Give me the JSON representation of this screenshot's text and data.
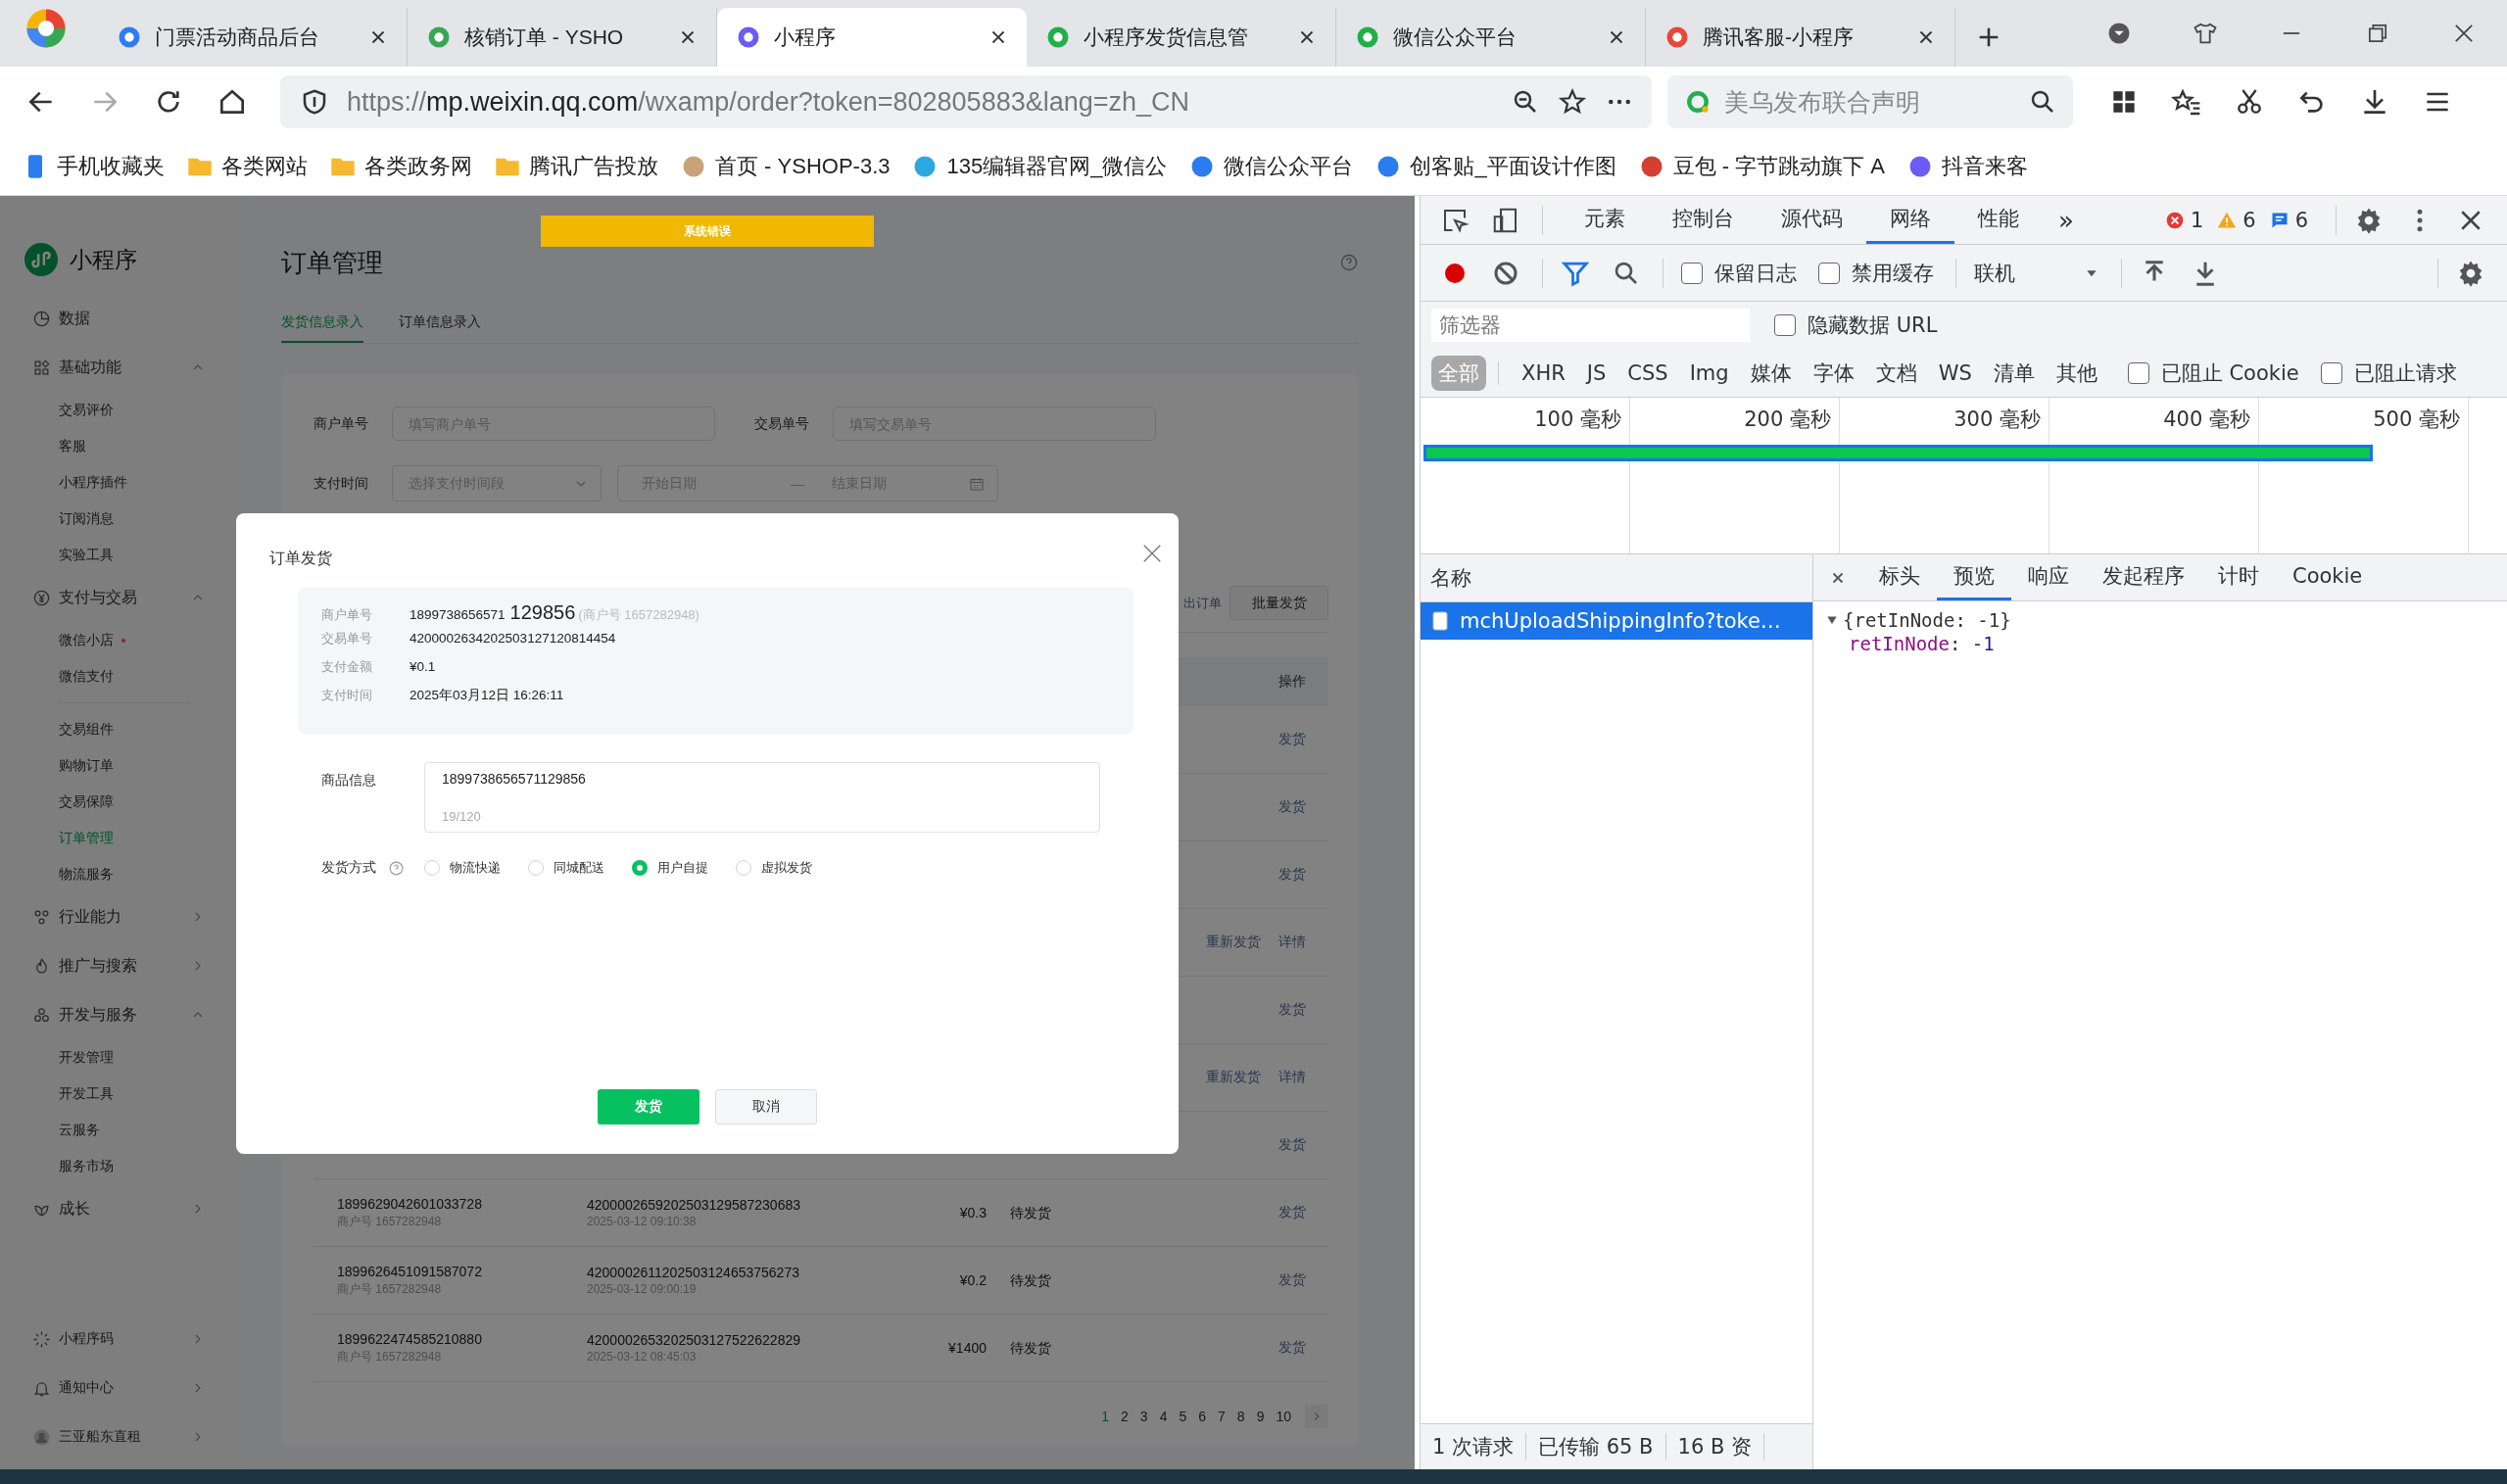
{
  "browser": {
    "tabs": [
      {
        "title": "门票活动商品后台",
        "selected": false
      },
      {
        "title": "核销订单 - YSHO",
        "selected": false
      },
      {
        "title": "小程序",
        "selected": true
      },
      {
        "title": "小程序发货信息管",
        "selected": false
      },
      {
        "title": "微信公众平台",
        "selected": false
      },
      {
        "title": "腾讯客服-小程序",
        "selected": false
      }
    ],
    "url": "https://**mp.weixin.qq.com**/wxamp/order?token=802805883&lang=zh_CN",
    "search": {
      "placeholder": "美乌发布联合声明"
    },
    "bookmarks": [
      {
        "label": "手机收藏夹",
        "kind": "phone"
      },
      {
        "label": "各类网站",
        "kind": "folder"
      },
      {
        "label": "各类政务网",
        "kind": "folder"
      },
      {
        "label": "腾讯广告投放",
        "kind": "folder"
      },
      {
        "label": "首页 - YSHOP-3.3",
        "kind": "site"
      },
      {
        "label": "135编辑器官网_微信公",
        "kind": "site"
      },
      {
        "label": "微信公众平台",
        "kind": "site"
      },
      {
        "label": "创客贴_平面设计作图",
        "kind": "site"
      },
      {
        "label": "豆包 - 字节跳动旗下 A",
        "kind": "site"
      },
      {
        "label": "抖音来客",
        "kind": "site"
      }
    ]
  },
  "page": {
    "error_banner": "系统错误",
    "sidebar": {
      "title": "小程序",
      "groups": [
        {
          "label": "数据"
        },
        {
          "label": "基础功能",
          "expanded": true,
          "children": [
            {
              "label": "交易评价",
              "selected": false
            },
            {
              "label": "客服",
              "selected": false
            },
            {
              "label": "小程序插件",
              "selected": false
            },
            {
              "label": "订阅消息",
              "selected": false
            },
            {
              "label": "实验工具",
              "selected": false
            }
          ]
        },
        {
          "label": "支付与交易",
          "expanded": true,
          "children": [
            {
              "label": "微信小店",
              "selected": false,
              "dot": true
            },
            {
              "label": "微信支付",
              "selected": false
            },
            {
              "label": "交易组件",
              "selected": false,
              "divider_before": true
            },
            {
              "label": "购物订单",
              "selected": false
            },
            {
              "label": "交易保障",
              "selected": false
            },
            {
              "label": "订单管理",
              "selected": true
            },
            {
              "label": "物流服务",
              "selected": false
            }
          ]
        },
        {
          "label": "行业能力",
          "expanded": false
        },
        {
          "label": "推广与搜索",
          "expanded": false
        },
        {
          "label": "开发与服务",
          "expanded": true,
          "children": [
            {
              "label": "开发管理",
              "selected": false
            },
            {
              "label": "开发工具",
              "selected": false
            },
            {
              "label": "云服务",
              "selected": false
            },
            {
              "label": "服务市场",
              "selected": false
            }
          ]
        },
        {
          "label": "成长",
          "expanded": false
        }
      ],
      "footer": [
        {
          "label": "小程序码"
        },
        {
          "label": "通知中心"
        },
        {
          "label": "三亚船东直租"
        }
      ]
    },
    "title": "订单管理",
    "tabs": [
      {
        "label": "发货信息录入",
        "selected": true
      },
      {
        "label": "订单信息录入",
        "selected": false
      }
    ],
    "filters": [
      {
        "label": "商户单号",
        "placeholder": "填写商户单号"
      },
      {
        "label": "交易单号",
        "placeholder": "填写交易单号"
      }
    ],
    "pay_time": {
      "label": "支付时间",
      "placeholder": "选择支付时间段",
      "start_placeholder": "开始日期",
      "separator": "—",
      "end_placeholder": "结束日期"
    },
    "export_link": "出订单",
    "batch_button": "批量发货",
    "table": {
      "action_header": "操作",
      "rows": [
        {
          "actions": [
            "发货"
          ]
        },
        {
          "actions": [
            "发货"
          ]
        },
        {
          "actions": [
            "发货"
          ]
        },
        {
          "actions": [
            "重新发货",
            "详情"
          ]
        },
        {
          "actions": [
            "发货"
          ]
        },
        {
          "actions": [
            "重新发货",
            "详情"
          ]
        },
        {
          "actions": [
            "发货"
          ]
        },
        {
          "merchant_no": "1899629042601033728",
          "merchant_id": "商户号 1657282948",
          "trade_no": "4200002659202503129587230683",
          "time": "2025-03-12 09:10:38",
          "amount": "¥0.3",
          "status": "待发货",
          "actions": [
            "发货"
          ]
        },
        {
          "merchant_no": "1899626451091587072",
          "merchant_id": "商户号 1657282948",
          "trade_no": "4200002611202503124653756273",
          "time": "2025-03-12 09:00:19",
          "amount": "¥0.2",
          "status": "待发货",
          "actions": [
            "发货"
          ]
        },
        {
          "merchant_no": "1899622474585210880",
          "merchant_id": "商户号 1657282948",
          "trade_no": "4200002653202503127522622829",
          "time": "2025-03-12 08:45:03",
          "amount": "¥1400",
          "status": "待发货",
          "actions": [
            "发货"
          ]
        }
      ]
    },
    "pagination": {
      "pages": [
        {
          "label": "1",
          "selected": true
        },
        {
          "label": "2",
          "selected": false
        },
        {
          "label": "3",
          "selected": false
        },
        {
          "label": "4",
          "selected": false
        },
        {
          "label": "5",
          "selected": false
        },
        {
          "label": "6",
          "selected": false
        },
        {
          "label": "7",
          "selected": false
        },
        {
          "label": "8",
          "selected": false
        },
        {
          "label": "9",
          "selected": false
        },
        {
          "label": "10",
          "selected": false
        }
      ]
    }
  },
  "modal": {
    "title": "订单发货",
    "info": [
      {
        "label": "商户单号",
        "value": "1899738656571",
        "value_large": "129856",
        "note": "(商户号 1657282948)"
      },
      {
        "label": "交易单号",
        "value": "4200002634202503127120814454"
      },
      {
        "label": "支付金额",
        "value": "¥0.1"
      },
      {
        "label": "支付时间",
        "value": "2025年03月12日 16:26:11"
      }
    ],
    "goods": {
      "label": "商品信息",
      "value": "1899738656571129856",
      "counter": "19/120"
    },
    "delivery": {
      "label": "发货方式",
      "options": [
        {
          "label": "物流快递",
          "selected": false
        },
        {
          "label": "同城配送",
          "selected": false
        },
        {
          "label": "用户自提",
          "selected": true
        },
        {
          "label": "虚拟发货",
          "selected": false
        }
      ]
    },
    "buttons": [
      {
        "label": "发货",
        "kind": "primary"
      },
      {
        "label": "取消",
        "kind": "default"
      }
    ]
  },
  "devtools": {
    "tabs": [
      {
        "label": "元素",
        "selected": false
      },
      {
        "label": "控制台",
        "selected": false
      },
      {
        "label": "源代码",
        "selected": false
      },
      {
        "label": "网络",
        "selected": true
      },
      {
        "label": "性能",
        "selected": false
      }
    ],
    "more": "»",
    "errors": "1",
    "warnings": "6",
    "messages": "6",
    "preserve_log": {
      "label": "保留日志",
      "checked": false
    },
    "disable_cache": {
      "label": "禁用缓存",
      "checked": false
    },
    "throttle": "联机",
    "filter": {
      "placeholder": "筛选器"
    },
    "hide_data_urls": {
      "label": "隐藏数据 URL",
      "checked": false
    },
    "types": [
      {
        "label": "全部",
        "selected": true
      },
      {
        "label": "XHR",
        "selected": false
      },
      {
        "label": "JS",
        "selected": false
      },
      {
        "label": "CSS",
        "selected": false
      },
      {
        "label": "Img",
        "selected": false
      },
      {
        "label": "媒体",
        "selected": false
      },
      {
        "label": "字体",
        "selected": false
      },
      {
        "label": "文档",
        "selected": false
      },
      {
        "label": "WS",
        "selected": false
      },
      {
        "label": "清单",
        "selected": false
      },
      {
        "label": "其他",
        "selected": false
      }
    ],
    "blocked_cookies": {
      "label": "已阻止 Cookie",
      "checked": false
    },
    "blocked_requests": {
      "label": "已阻止请求",
      "checked": false
    },
    "timeline_ticks": [
      "100 毫秒",
      "200 毫秒",
      "300 毫秒",
      "400 毫秒",
      "500 毫秒"
    ],
    "name_header": "名称",
    "requests": [
      {
        "name": "mchUploadShippingInfo?toke…",
        "selected": true
      }
    ],
    "detail_tabs": [
      {
        "label": "标头",
        "selected": false
      },
      {
        "label": "预览",
        "selected": true
      },
      {
        "label": "响应",
        "selected": false
      },
      {
        "label": "发起程序",
        "selected": false
      },
      {
        "label": "计时",
        "selected": false
      },
      {
        "label": "Cookie",
        "selected": false
      }
    ],
    "preview": {
      "summary": "{retInNode: -1}",
      "expanded": true,
      "key": "retInNode",
      "separator": ": ",
      "value": "-1"
    },
    "status": [
      "1 次请求",
      "已传输 65 B",
      "16 B 资"
    ]
  }
}
